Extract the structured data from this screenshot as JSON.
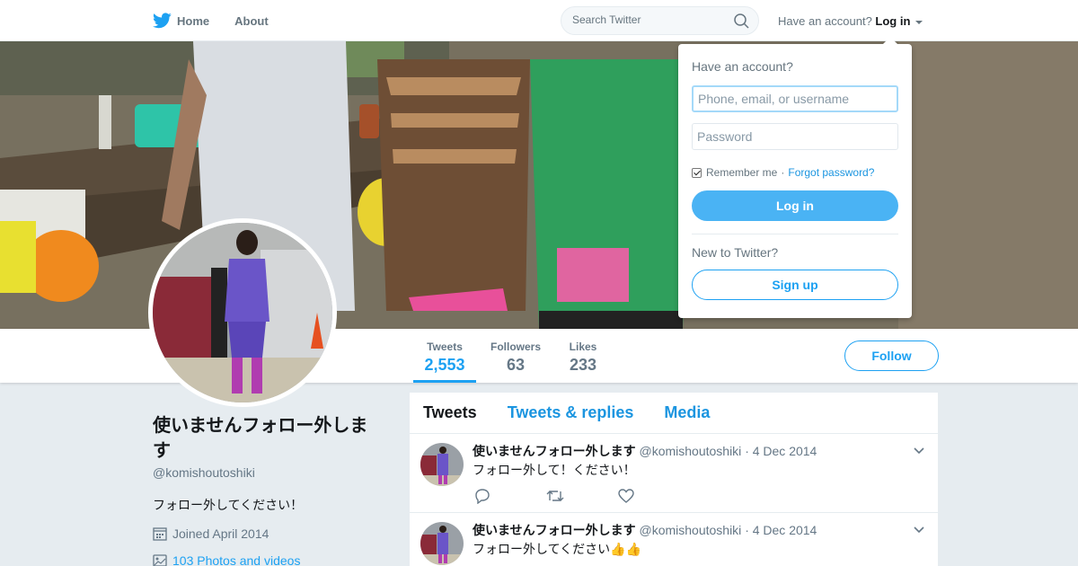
{
  "nav": {
    "home_label": "Home",
    "about_label": "About",
    "search_placeholder": "Search Twitter",
    "account_prompt": "Have an account?",
    "login_label": "Log in"
  },
  "profile": {
    "name": "使いませんフォロー外します",
    "handle": "@komishoutoshiki",
    "bio": "フォロー外してください！",
    "joined": "Joined April 2014",
    "photos": "103 Photos and videos"
  },
  "stats": [
    {
      "label": "Tweets",
      "value": "2,553"
    },
    {
      "label": "Followers",
      "value": "63"
    },
    {
      "label": "Likes",
      "value": "233"
    }
  ],
  "follow_label": "Follow",
  "timeline": {
    "tabs": [
      "Tweets",
      "Tweets & replies",
      "Media"
    ],
    "tweets": [
      {
        "name": "使いませんフォロー外します",
        "handle": "@komishoutoshiki",
        "date": "· 4 Dec 2014",
        "text": "フォロー外して！ください！"
      },
      {
        "name": "使いませんフォロー外します",
        "handle": "@komishoutoshiki",
        "date": "· 4 Dec 2014",
        "text": "フォロー外してください👍👍"
      }
    ]
  },
  "login_dropdown": {
    "title": "Have an account?",
    "username_placeholder": "Phone, email, or username",
    "password_placeholder": "Password",
    "remember_label": "Remember me",
    "separator": "·",
    "forgot_label": "Forgot password?",
    "login_button": "Log in",
    "new_prompt": "New to Twitter?",
    "signup_button": "Sign up"
  },
  "colors": {
    "accent": "#1da1f2",
    "login_button": "#4ab3f4",
    "background": "#e6ecf0"
  }
}
